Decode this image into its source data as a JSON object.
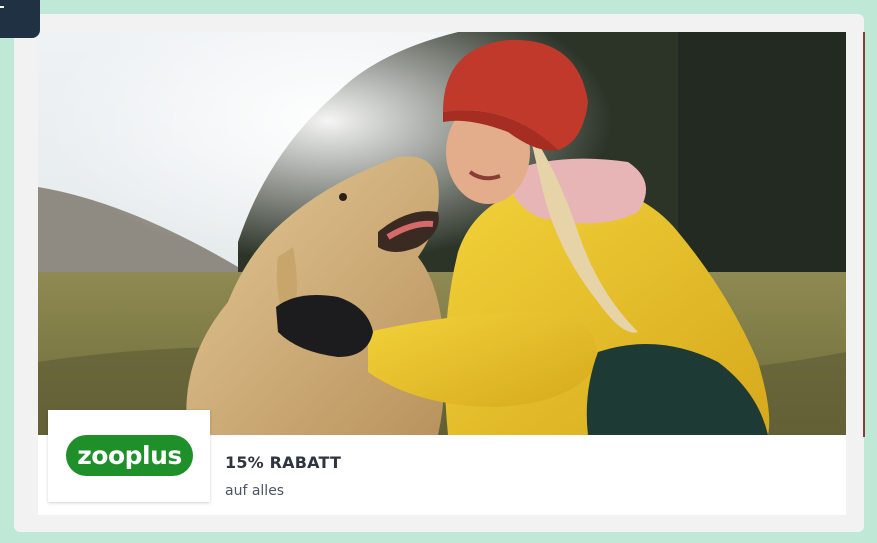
{
  "ad": {
    "brand": "zooplus",
    "offer_title": "15% RABATT",
    "offer_subtitle": "auf alles",
    "image_icon": "photo-woman-with-dog",
    "colors": {
      "background": "#bfe8d6",
      "brand_green": "#1f8f2a",
      "corner_tab": "#1f3142"
    }
  }
}
